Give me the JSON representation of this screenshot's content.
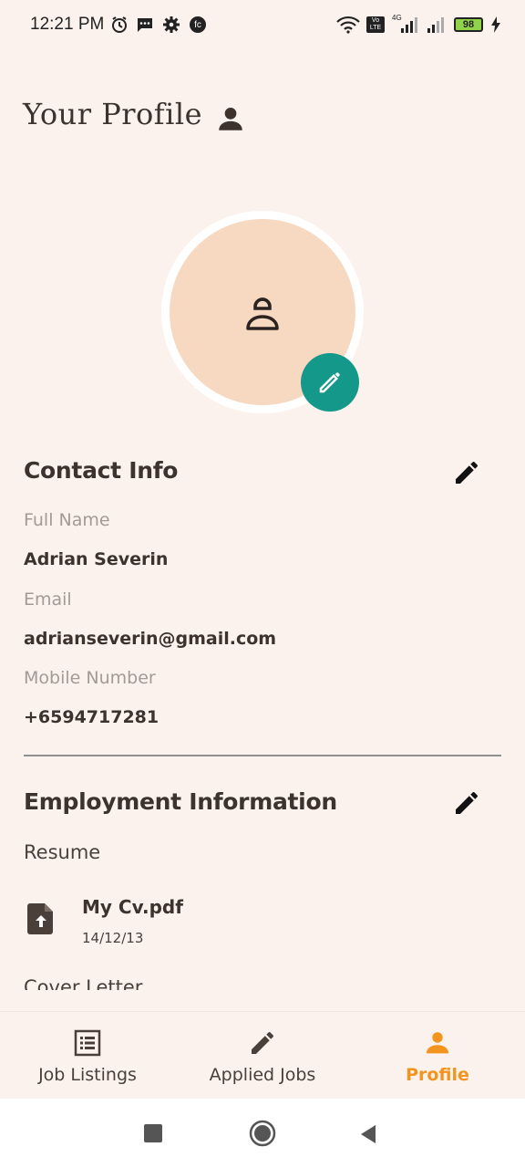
{
  "status_bar": {
    "time": "12:21 PM",
    "battery": "98",
    "icons": [
      "alarm-icon",
      "message-icon",
      "settings-icon",
      "fc-icon",
      "wifi-icon",
      "volte-icon",
      "signal-icon",
      "signal-icon-2",
      "charging-icon"
    ],
    "volte_label": "Vo LTE",
    "network_label": "4G",
    "fc_label": "fc"
  },
  "header": {
    "title": "Your Profile",
    "icon": "person-icon"
  },
  "avatar": {
    "icon": "person-outline-icon",
    "edit_icon": "pencil-icon"
  },
  "contact": {
    "title": "Contact Info",
    "fields": [
      {
        "label": "Full Name",
        "value": "Adrian Severin"
      },
      {
        "label": "Email",
        "value": "adrianseverin@gmail.com"
      },
      {
        "label": "Mobile Number",
        "value": "+6594717281"
      }
    ]
  },
  "employment": {
    "title": "Employment Information",
    "resume_label": "Resume",
    "resume": {
      "name": "My Cv.pdf",
      "date": "14/12/13",
      "icon": "file-upload-icon"
    },
    "cover_letter_label": "Cover Letter"
  },
  "bottom_nav": {
    "items": [
      {
        "label": "Job Listings",
        "icon": "list-icon",
        "active": false
      },
      {
        "label": "Applied Jobs",
        "icon": "pencil-icon",
        "active": false
      },
      {
        "label": "Profile",
        "icon": "person-icon",
        "active": true
      }
    ],
    "active_color": "#f2941e"
  },
  "colors": {
    "background": "#fcf2ed",
    "accent_teal": "#14988a",
    "avatar_fill": "#f7d9c2",
    "text_dark": "#3d322c",
    "label_gray": "#a49a94"
  }
}
